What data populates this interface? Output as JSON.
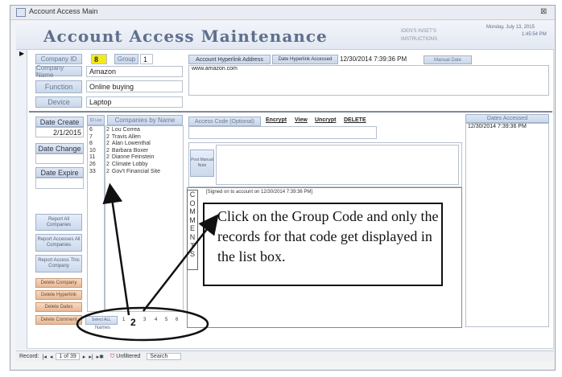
{
  "window": {
    "title": "Account Access Main",
    "close_glyph": "⊠"
  },
  "header": {
    "app_title": "Account Access Maintenance",
    "center_top": "IDEN'S INSET'S",
    "center_bottom": "INSTRUCTIONS",
    "date": "Monday, July 13, 2015",
    "time": "1:45:54 PM"
  },
  "company": {
    "company_id_label": "Company ID",
    "company_id_value": "8",
    "group_label": "Group",
    "group_value": "1",
    "company_name_label": "Company Name",
    "company_name_value": "Amazon",
    "function_label": "Function",
    "function_value": "Online buying",
    "device_label": "Device",
    "device_value": "Laptop"
  },
  "hyperlink": {
    "address_label": "Account Hyperlink Address",
    "accessed_label": "Date Hyperlink Accessed",
    "accessed_value": "12/30/2014 7:39:36 PM",
    "manual_date_button": "Manual Date",
    "url": "www.amazon.com"
  },
  "dates": {
    "create_label": "Date Create",
    "create_value": "2/1/2015",
    "change_label": "Date Change",
    "expire_label": "Date Expire"
  },
  "companies_list": {
    "id_header": "ID List",
    "name_header": "Companies by Name",
    "rows": [
      {
        "id": "6",
        "group": "2",
        "name": "Lou Correa"
      },
      {
        "id": "7",
        "group": "2",
        "name": "Travis Allen"
      },
      {
        "id": "8",
        "group": "2",
        "name": "Alan Lowenthal"
      },
      {
        "id": "10",
        "group": "2",
        "name": "Barbara Boxer"
      },
      {
        "id": "11",
        "group": "2",
        "name": "Dianne Feinstein"
      },
      {
        "id": "26",
        "group": "2",
        "name": "Climate Lobby"
      },
      {
        "id": "33",
        "group": "2",
        "name": "Gov't Financial Site"
      }
    ]
  },
  "access_code": {
    "label": "Access Code (Optional)",
    "encrypt": "Encrypt",
    "view": "View",
    "uncrypt": "Uncrypt",
    "delete": "DELETE",
    "post_manual_note": "Post Manual Note"
  },
  "comments": {
    "side_label": "C O M M E N T S",
    "note": "[Signed on to account on 12/30/2014 7:39:36 PM]"
  },
  "dates_accessed": {
    "header": "Dates Accessed",
    "entries": [
      "12/30/2014 7:39:36 PM"
    ]
  },
  "buttons": {
    "report_all": "Report All Companies",
    "report_accesses": "Report Accesses All Companies",
    "report_access_this": "Report Access This Company",
    "delete_company": "Delete Company",
    "delete_hyperlink": "Delete Hyperlink",
    "delete_dates": "Delete Dates",
    "delete_comment": "Delete Comment"
  },
  "group_filter": {
    "select_all": "Select ALL",
    "names_label": "Names",
    "groups": [
      "1",
      "2",
      "3",
      "4",
      "5",
      "6"
    ]
  },
  "callout": {
    "text": "Click on the Group Code and only the records for that code get displayed in the list box."
  },
  "statusbar": {
    "record_label": "Record:",
    "first": "|◂",
    "prev": "◂",
    "position": "1 of 39",
    "next": "▸",
    "last": "▸|",
    "new": "▸✱",
    "filter": "Unfiltered",
    "search": "Search"
  },
  "colors": {
    "group_highlight": "#f3ea1a",
    "label_blue": "#c9d7ea",
    "button_orange": "#e8b896"
  }
}
